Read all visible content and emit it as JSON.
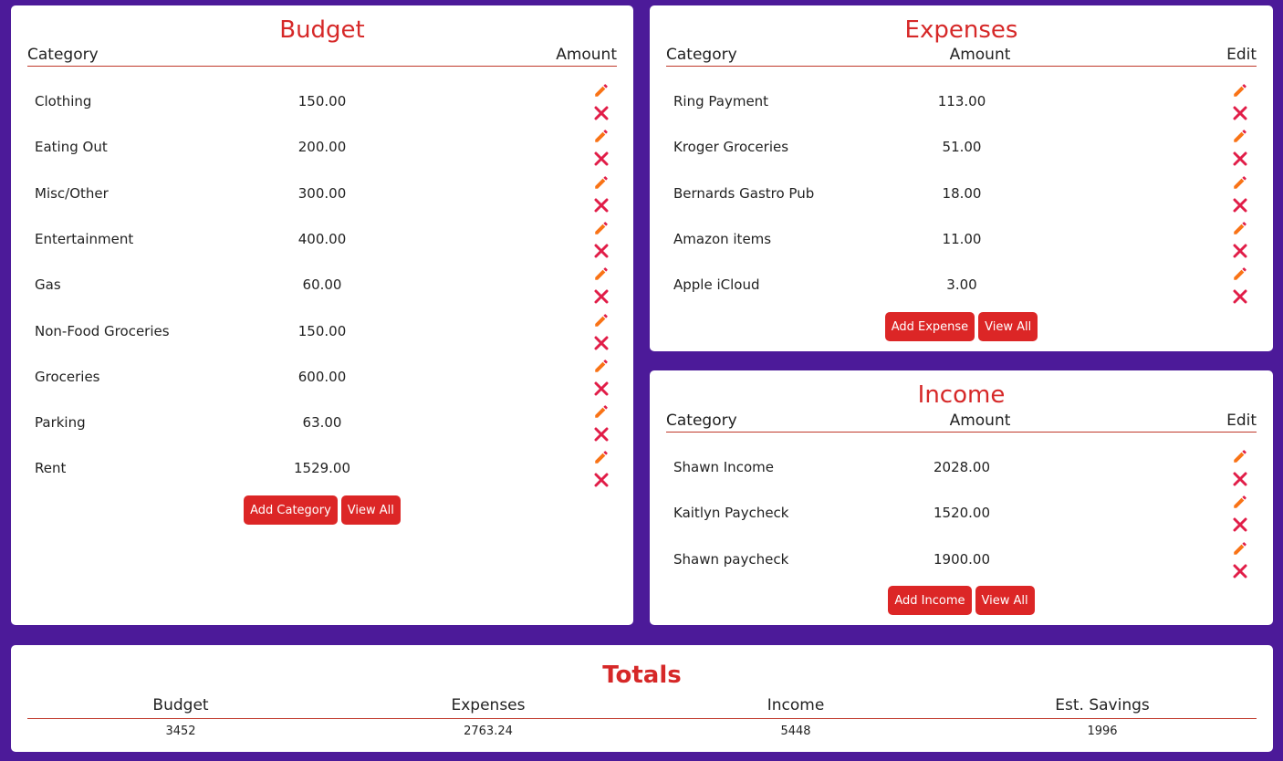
{
  "budget": {
    "title": "Budget",
    "headers": {
      "category": "Category",
      "amount": "Amount"
    },
    "rows": [
      {
        "category": "Clothing",
        "amount": "150.00"
      },
      {
        "category": "Eating Out",
        "amount": "200.00"
      },
      {
        "category": "Misc/Other",
        "amount": "300.00"
      },
      {
        "category": "Entertainment",
        "amount": "400.00"
      },
      {
        "category": "Gas",
        "amount": "60.00"
      },
      {
        "category": "Non-Food Groceries",
        "amount": "150.00"
      },
      {
        "category": "Groceries",
        "amount": "600.00"
      },
      {
        "category": "Parking",
        "amount": "63.00"
      },
      {
        "category": "Rent",
        "amount": "1529.00"
      }
    ],
    "add_label": "Add Category",
    "view_all_label": "View All"
  },
  "expenses": {
    "title": "Expenses",
    "headers": {
      "category": "Category",
      "amount": "Amount",
      "edit": "Edit"
    },
    "rows": [
      {
        "category": "Ring Payment",
        "amount": "113.00"
      },
      {
        "category": "Kroger Groceries",
        "amount": "51.00"
      },
      {
        "category": "Bernards Gastro Pub",
        "amount": "18.00"
      },
      {
        "category": "Amazon items",
        "amount": "11.00"
      },
      {
        "category": "Apple iCloud",
        "amount": "3.00"
      }
    ],
    "add_label": "Add Expense",
    "view_all_label": "View All"
  },
  "income": {
    "title": "Income",
    "headers": {
      "category": "Category",
      "amount": "Amount",
      "edit": "Edit"
    },
    "rows": [
      {
        "category": "Shawn Income",
        "amount": "2028.00"
      },
      {
        "category": "Kaitlyn Paycheck",
        "amount": "1520.00"
      },
      {
        "category": "Shawn paycheck",
        "amount": "1900.00"
      }
    ],
    "add_label": "Add Income",
    "view_all_label": "View All"
  },
  "totals": {
    "title": "Totals",
    "headers": [
      "Budget",
      "Expenses",
      "Income",
      "Est. Savings"
    ],
    "values": [
      "3452",
      "2763.24",
      "5448",
      "1996"
    ]
  },
  "icons": {
    "edit": "pencil-icon",
    "delete": "close-icon"
  },
  "colors": {
    "background": "#4c1a99",
    "title": "#d62828",
    "button": "#dc2626",
    "pencil": "#f97316",
    "delete": "#e11d48"
  }
}
